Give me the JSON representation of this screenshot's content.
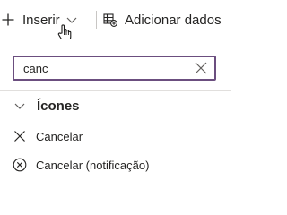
{
  "toolbar": {
    "insert_label": "Inserir",
    "add_data_label": "Adicionar dados"
  },
  "search": {
    "value": "canc",
    "border_color": "#6b4e7f"
  },
  "results": {
    "group_title": "Ícones",
    "items": [
      {
        "label": "Cancelar",
        "icon": "cancel-icon"
      },
      {
        "label": "Cancelar (notificação)",
        "icon": "cancel-badge-icon"
      }
    ]
  }
}
